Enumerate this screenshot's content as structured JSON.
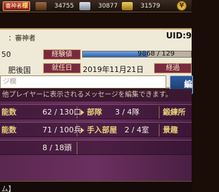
{
  "header": {
    "badge_label": "審神者",
    "badge_mark": "様",
    "resources": [
      "34755",
      "30877",
      "31579"
    ],
    "resource_icons": [
      "wood-icon",
      "steel-icon",
      "gold-icon"
    ],
    "coin_icon": "coin-icon"
  },
  "profile": {
    "name": "：審神者",
    "uid": "UID:9",
    "level": "50",
    "exp_label": "経験値",
    "exp_value": "9868 / 129",
    "exp_fill_fraction": 0.6,
    "location": "肥後国",
    "since_label": "就任日",
    "since_date": "2019年11月21日",
    "elapsed_label": "経過"
  },
  "message": {
    "placeholder": "ジ欄",
    "edit_button": "編",
    "note": "他プレイヤーに表示されるメッセージを編集できます。"
  },
  "stats": [
    {
      "label": "能数",
      "value": "62 / 130口",
      "label2": "部隊",
      "value2": "3 / 4隊",
      "label3": "鍛練所"
    },
    {
      "label": "能数",
      "value": "71 / 100兵",
      "label2": "手入部屋",
      "value2": "2 / 4室",
      "label3": "景趣"
    },
    {
      "label": "",
      "value": "8 / 18頭"
    }
  ],
  "footer": {
    "text": "ム】"
  },
  "colors": {
    "accent": "#7a2a3f",
    "gold": "#e6cf7a",
    "panel": "#efe9d8",
    "stats_bg": "#5a2850"
  }
}
